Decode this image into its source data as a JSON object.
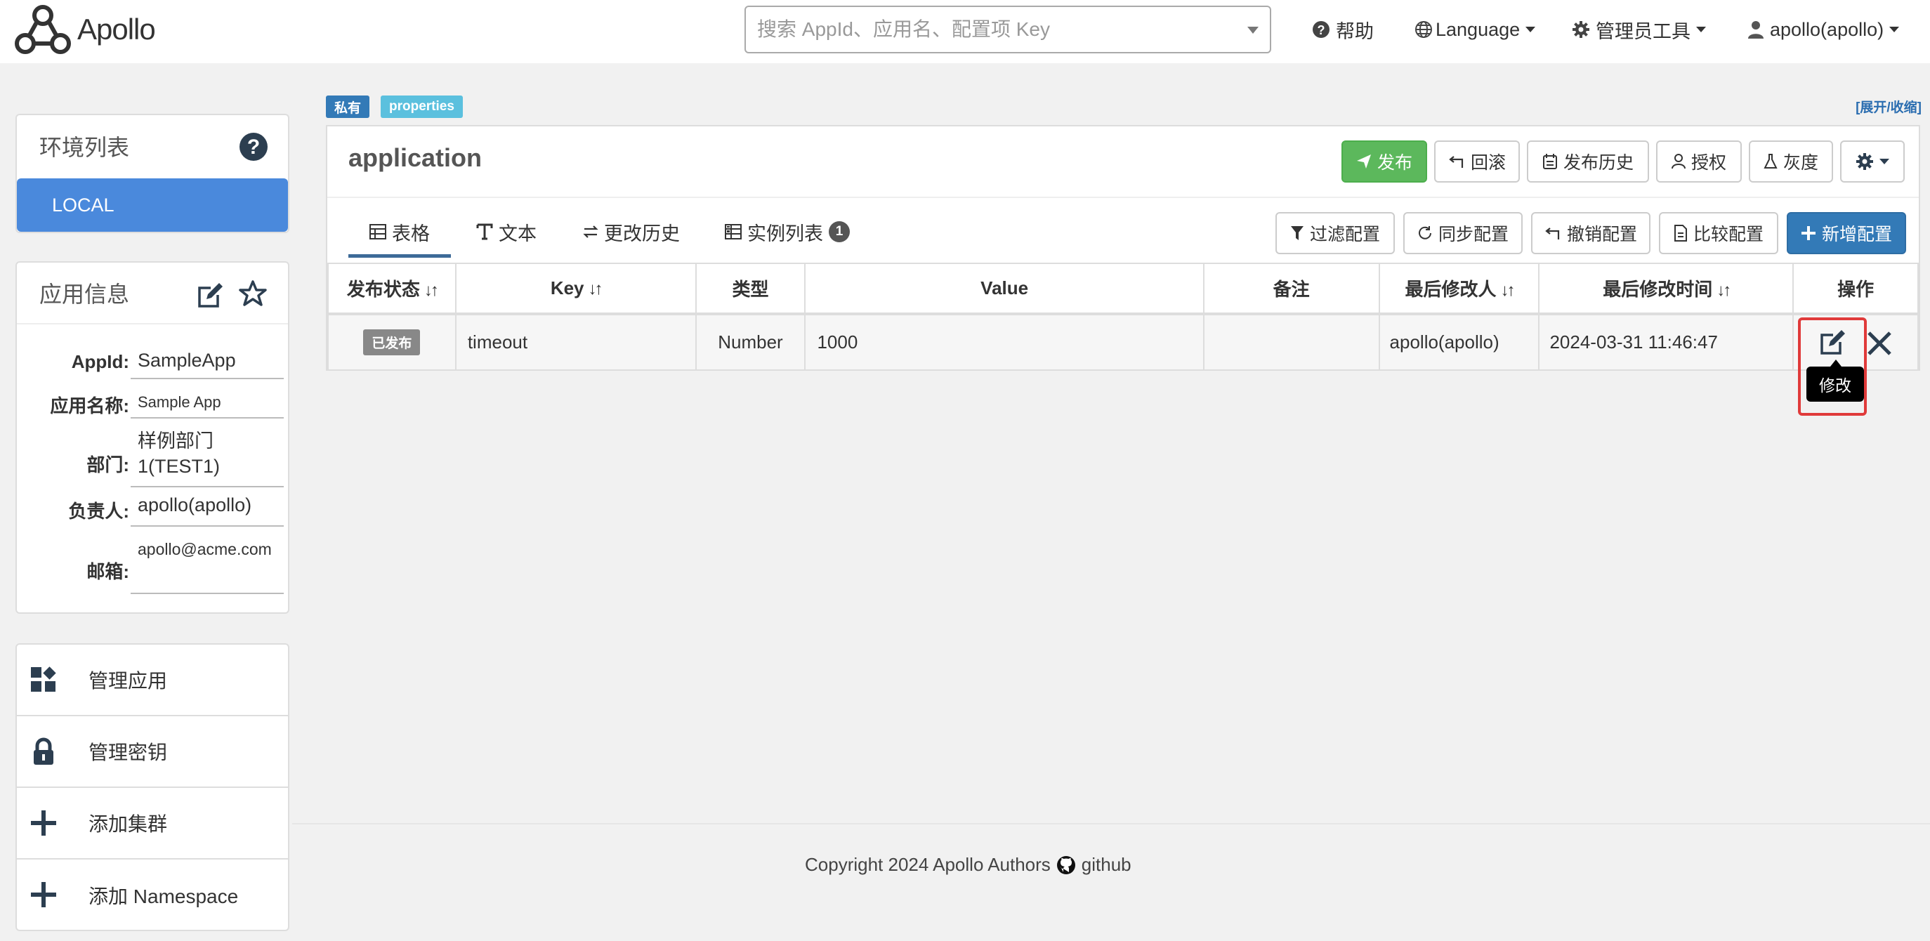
{
  "header": {
    "logo_text": "Apollo",
    "search_placeholder": "搜索 AppId、应用名、配置项 Key",
    "nav": {
      "help": "帮助",
      "language": "Language",
      "admin_tools": "管理员工具",
      "user": "apollo(apollo)"
    }
  },
  "sidebar": {
    "env_panel": {
      "title": "环境列表",
      "env": "LOCAL"
    },
    "app_info": {
      "title": "应用信息",
      "rows": [
        {
          "label": "AppId:",
          "value": "SampleApp"
        },
        {
          "label": "应用名称:",
          "value": "Sample App"
        },
        {
          "label": "部门:",
          "value": "样例部门1(TEST1)"
        },
        {
          "label": "负责人:",
          "value": "apollo(apollo)"
        },
        {
          "label": "邮箱:",
          "value": "apollo@acme.com"
        }
      ]
    },
    "menu": [
      {
        "label": "管理应用",
        "icon": "apps-icon"
      },
      {
        "label": "管理密钥",
        "icon": "lock-icon"
      },
      {
        "label": "添加集群",
        "icon": "plus-icon"
      },
      {
        "label": "添加 Namespace",
        "icon": "plus-icon"
      }
    ]
  },
  "namespace": {
    "tag_private": "私有",
    "tag_format": "properties",
    "toggle": "[展开/收缩]",
    "title": "application",
    "actions": {
      "publish": "发布",
      "rollback": "回滚",
      "publish_history": "发布历史",
      "authorize": "授权",
      "gray": "灰度"
    },
    "tabs": [
      {
        "label": "表格",
        "icon": "table-icon",
        "active": true
      },
      {
        "label": "文本",
        "icon": "text-icon"
      },
      {
        "label": "更改历史",
        "icon": "exchange-icon"
      },
      {
        "label": "实例列表",
        "icon": "instances-icon",
        "badge": "1"
      }
    ],
    "tools": {
      "filter": "过滤配置",
      "sync": "同步配置",
      "revoke": "撤销配置",
      "compare": "比较配置",
      "add": "新增配置"
    },
    "table": {
      "columns": [
        "发布状态",
        "Key",
        "类型",
        "Value",
        "备注",
        "最后修改人",
        "最后修改时间",
        "操作"
      ],
      "rows": [
        {
          "status": "已发布",
          "key": "timeout",
          "type": "Number",
          "value": "1000",
          "comment": "",
          "modifier": "apollo(apollo)",
          "modified_time": "2024-03-31 11:46:47"
        }
      ]
    },
    "tooltip_edit": "修改"
  },
  "footer": {
    "copyright": "Copyright 2024 Apollo Authors",
    "link": "github"
  },
  "colors": {
    "primary_blue": "#4a89dc",
    "publish_green": "#5cb85c",
    "highlight_red": "#e03a3a"
  }
}
